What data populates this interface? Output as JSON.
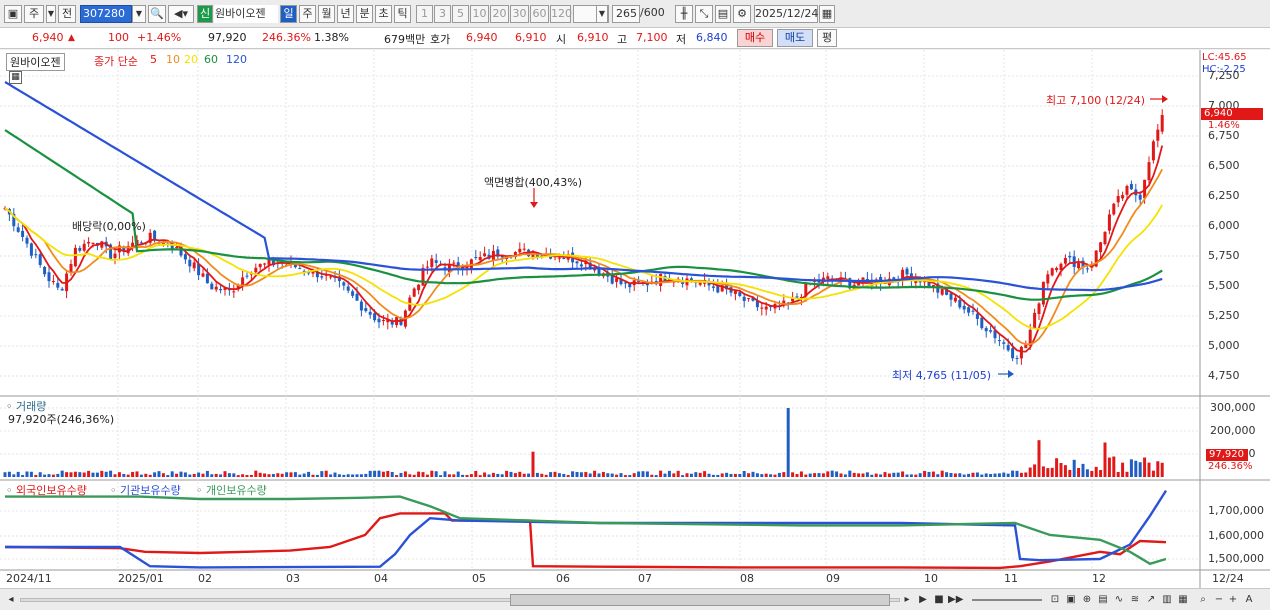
{
  "toolbar": {
    "period_mode": "주",
    "prev_label": "전",
    "stock_code": "307280",
    "credit_badge": "신",
    "stock_name": "원바이오젠",
    "period_tabs": [
      "일",
      "주",
      "월",
      "년",
      "분",
      "초",
      "틱"
    ],
    "active_period": "일",
    "minute_options": [
      "1",
      "3",
      "5",
      "10",
      "20",
      "30",
      "60",
      "120"
    ],
    "count_display": "265",
    "count_total": "/600",
    "date": "2025/12/24"
  },
  "quote": {
    "price": "6,940",
    "change": "100",
    "change_pct": "+1.46%",
    "volume": "97,920",
    "volume_ratio": "246.36%",
    "turnover": "1.38%",
    "amount": "679백만",
    "hoga_label": "호가",
    "ask": "6,940",
    "bid": "6,910",
    "open_label": "시",
    "open": "6,910",
    "high_label": "고",
    "high": "7,100",
    "low_label": "저",
    "low": "6,840",
    "buy_label": "매수",
    "sell_label": "매도",
    "eval_label": "평"
  },
  "price_panel": {
    "stock_name": "원바이오젠",
    "ma_title": "종가 단순",
    "ma_periods": [
      {
        "label": "5",
        "color": "#e01818"
      },
      {
        "label": "10",
        "color": "#f08c1c"
      },
      {
        "label": "20",
        "color": "#f5e200"
      },
      {
        "label": "60",
        "color": "#1a9140"
      },
      {
        "label": "120",
        "color": "#2a52d6"
      }
    ],
    "lc_label": "LC:45.65",
    "hc_label": "HC:-2.25",
    "last_price_tag": "6,940",
    "last_pct_tag": "1.46%",
    "high_annot": "최고 7,100 (12/24)",
    "low_annot": "최저 4,765 (11/05)",
    "dividend_annot": "배당락(0,00%)",
    "split_annot": "액면병합(400,43%)",
    "y_ticks": [
      "7,250",
      "7,000",
      "6,750",
      "6,500",
      "6,250",
      "6,000",
      "5,750",
      "5,500",
      "5,250",
      "5,000",
      "4,750"
    ]
  },
  "volume_panel": {
    "title": "거래량",
    "value_label": "97,920주(246,36%)",
    "y_ticks": [
      "300,000",
      "200,000",
      "100,000"
    ],
    "last_value_tag": "97,920",
    "last_pct_tag": "246.36%"
  },
  "holdings_panel": {
    "legend": [
      "외국인보유수량",
      "기관보유수량",
      "개인보유수량"
    ],
    "y_ticks": [
      "1,700,000",
      "1,600,000",
      "1,500,000"
    ]
  },
  "x_axis": {
    "labels": [
      "2024/11",
      "2025/01",
      "02",
      "03",
      "04",
      "05",
      "06",
      "07",
      "08",
      "09",
      "10",
      "11",
      "12"
    ],
    "right_label": "12/24"
  },
  "colors": {
    "up": "#e01818",
    "down": "#1f5fc4",
    "ma5": "#e01818",
    "ma10": "#f08c1c",
    "ma20": "#f5e200",
    "ma60": "#1a9140",
    "ma120": "#2a52d6",
    "foreign": "#e01818",
    "institution": "#2a52d6",
    "individual": "#3a9a5a"
  }
}
